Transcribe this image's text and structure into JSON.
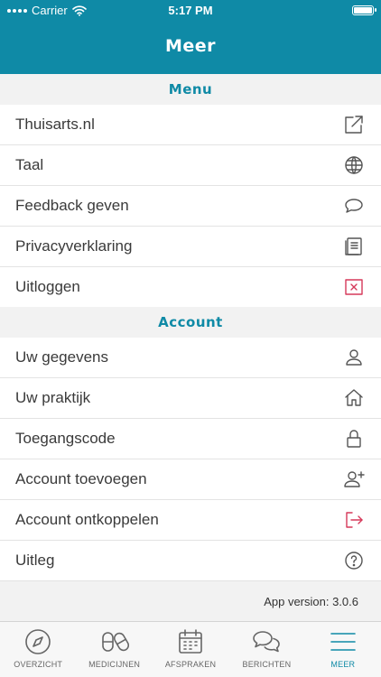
{
  "status_bar": {
    "carrier": "Carrier",
    "time": "5:17 PM"
  },
  "header": {
    "title": "Meer"
  },
  "sections": {
    "menu": {
      "label": "Menu",
      "items": [
        {
          "label": "Thuisarts.nl",
          "icon": "external-link-icon"
        },
        {
          "label": "Taal",
          "icon": "globe-icon"
        },
        {
          "label": "Feedback geven",
          "icon": "speech-bubble-icon"
        },
        {
          "label": "Privacyverklaring",
          "icon": "document-icon"
        },
        {
          "label": "Uitloggen",
          "icon": "close-box-icon"
        }
      ]
    },
    "account": {
      "label": "Account",
      "items": [
        {
          "label": "Uw gegevens",
          "icon": "user-icon"
        },
        {
          "label": "Uw praktijk",
          "icon": "home-icon"
        },
        {
          "label": "Toegangscode",
          "icon": "lock-icon"
        },
        {
          "label": "Account toevoegen",
          "icon": "add-user-icon"
        },
        {
          "label": "Account ontkoppelen",
          "icon": "logout-icon"
        },
        {
          "label": "Uitleg",
          "icon": "help-icon"
        }
      ]
    }
  },
  "app_version": "App version: 3.0.6",
  "tabs": [
    {
      "label": "OVERZICHT",
      "icon": "compass-icon"
    },
    {
      "label": "MEDICIJNEN",
      "icon": "pills-icon"
    },
    {
      "label": "AFSPRAKEN",
      "icon": "calendar-icon"
    },
    {
      "label": "BERICHTEN",
      "icon": "chat-icon"
    },
    {
      "label": "MEER",
      "icon": "menu-icon",
      "active": true
    }
  ],
  "colors": {
    "brand": "#0f8aa6",
    "danger": "#d6395a"
  }
}
